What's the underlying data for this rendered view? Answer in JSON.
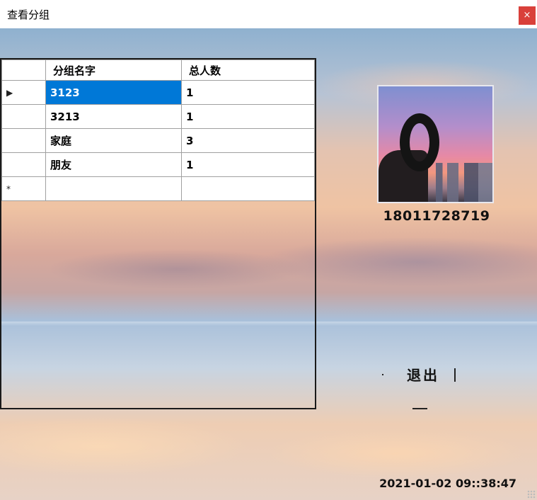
{
  "window": {
    "title": "查看分组",
    "close_label": "×"
  },
  "grid": {
    "columns": [
      "分组名字",
      "总人数"
    ],
    "rows": [
      {
        "marker": "▶",
        "name": "3123",
        "count": "1",
        "selected": true
      },
      {
        "marker": "",
        "name": "3213",
        "count": "1",
        "selected": false
      },
      {
        "marker": "",
        "name": "家庭",
        "count": "3",
        "selected": false
      },
      {
        "marker": "",
        "name": "朋友",
        "count": "1",
        "selected": false
      }
    ],
    "new_row_marker": "*"
  },
  "profile": {
    "avatar_icon": "camera-lens-photo",
    "phone": "18011728719"
  },
  "actions": {
    "exit_label": "退出"
  },
  "status": {
    "datetime": "2021-01-02  09::38:47"
  },
  "colors": {
    "selection": "#0078d7",
    "close_button": "#d9403a"
  }
}
